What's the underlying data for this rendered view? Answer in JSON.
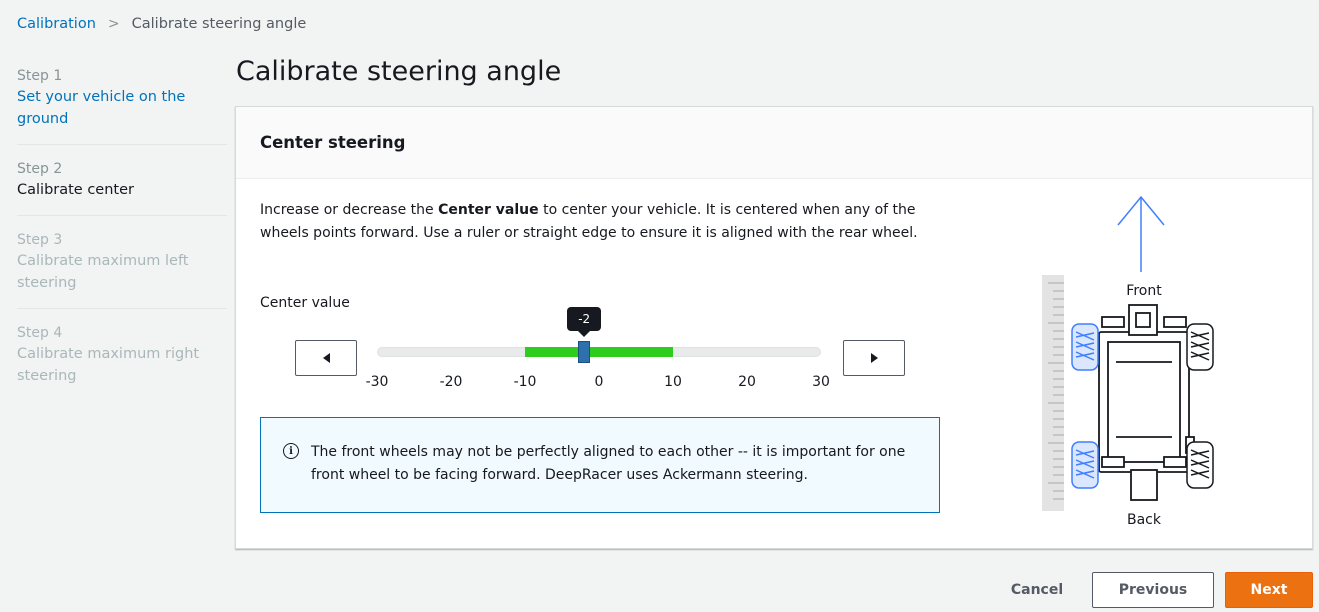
{
  "breadcrumb": {
    "root": "Calibration",
    "separator": ">",
    "current": "Calibrate steering angle"
  },
  "steps": [
    {
      "number": "Step 1",
      "label": "Set your vehicle on the ground",
      "state": "visited"
    },
    {
      "number": "Step 2",
      "label": "Calibrate center",
      "state": "active"
    },
    {
      "number": "Step 3",
      "label": "Calibrate maximum left steering",
      "state": "disabled"
    },
    {
      "number": "Step 4",
      "label": "Calibrate maximum right steering",
      "state": "disabled"
    }
  ],
  "page_title": "Calibrate steering angle",
  "panel": {
    "title": "Center steering",
    "description_before": "Increase or decrease the ",
    "description_bold": "Center value",
    "description_after": " to center your vehicle. It is centered when any of the wheels points forward. Use a ruler or straight edge to ensure it is aligned with the rear wheel.",
    "center_label": "Center value"
  },
  "slider": {
    "min": -30,
    "max": 30,
    "value": -2,
    "value_label": "-2",
    "range_min": -10,
    "range_max": 10,
    "ticks": [
      "-30",
      "-20",
      "-10",
      "0",
      "10",
      "20",
      "30"
    ],
    "decrease_icon": "triangle-left-icon",
    "increase_icon": "triangle-right-icon"
  },
  "info": {
    "icon": "info-circle-icon",
    "text": "The front wheels may not be perfectly aligned to each other -- it is important for one front wheel to be facing forward. DeepRacer uses Ackermann steering."
  },
  "diagram": {
    "front_label": "Front",
    "back_label": "Back"
  },
  "footer": {
    "cancel": "Cancel",
    "previous": "Previous",
    "next": "Next"
  },
  "colors": {
    "link": "#0073bb",
    "accent_orange": "#ec7211",
    "range_green": "#2ecc1d",
    "thumb_blue": "#2e6fad",
    "wheel_blue": "#3f7fff"
  }
}
